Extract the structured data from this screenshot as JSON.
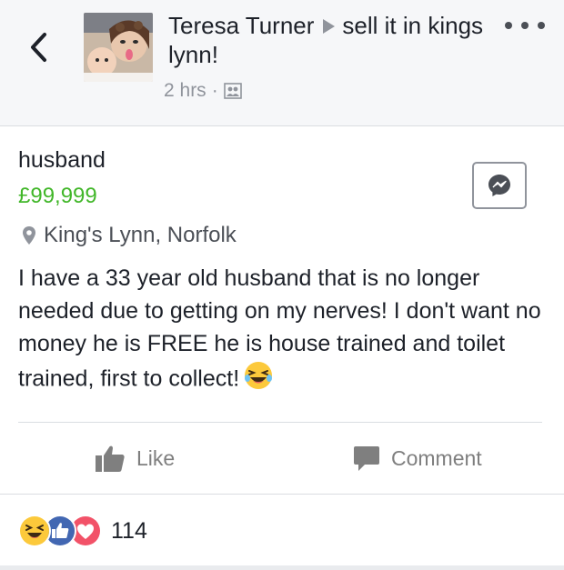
{
  "post": {
    "author": "Teresa Turner",
    "group": "sell it in kings lynn!",
    "time": "2 hrs",
    "privacy_icon": "group-icon"
  },
  "listing": {
    "title": "husband",
    "price": "£99,999",
    "location": "King's Lynn, Norfolk",
    "description": "I have a 33 year old husband that is no longer needed due to getting on my nerves! I don't want no money he is FREE he is house trained and toilet trained, first to collect!"
  },
  "actions": {
    "like_label": "Like",
    "comment_label": "Comment"
  },
  "reactions": {
    "types": [
      "haha",
      "like",
      "love"
    ],
    "count": "114"
  },
  "colors": {
    "price": "#42b72a",
    "like_blue": "#4267b2",
    "love_red": "#f25268",
    "haha_yellow": "#fcc93b"
  }
}
